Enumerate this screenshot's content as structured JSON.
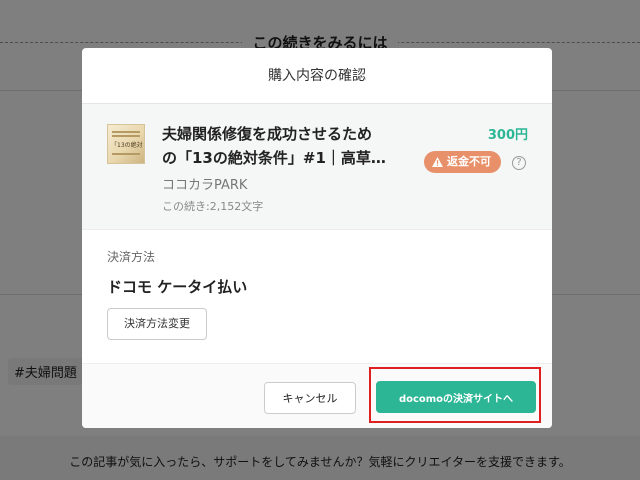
{
  "background": {
    "heading": "この続きをみるには",
    "tag": "#夫婦問題",
    "support_text": "この記事が気に入ったら、サポートをしてみませんか？気軽にクリエイターを支援できます。"
  },
  "modal": {
    "title": "購入内容の確認",
    "product": {
      "title_line1": "夫婦関係修復を成功させるため",
      "title_line2": "の「13の絶対条件」#1｜高草…",
      "thumbnail_text": "「13の絶対",
      "creator": "ココカラPARK",
      "remaining": "この続き:2,152文字",
      "price": "300円",
      "badge": "返金不可",
      "help": "?"
    },
    "payment": {
      "label": "決済方法",
      "method": "ドコモ ケータイ払い",
      "change_button": "決済方法変更"
    },
    "footer": {
      "cancel": "キャンセル",
      "proceed": "docomoの決済サイトへ"
    }
  },
  "colors": {
    "accent": "#2cb696",
    "badge": "#e8906a",
    "highlight": "#e02020"
  }
}
